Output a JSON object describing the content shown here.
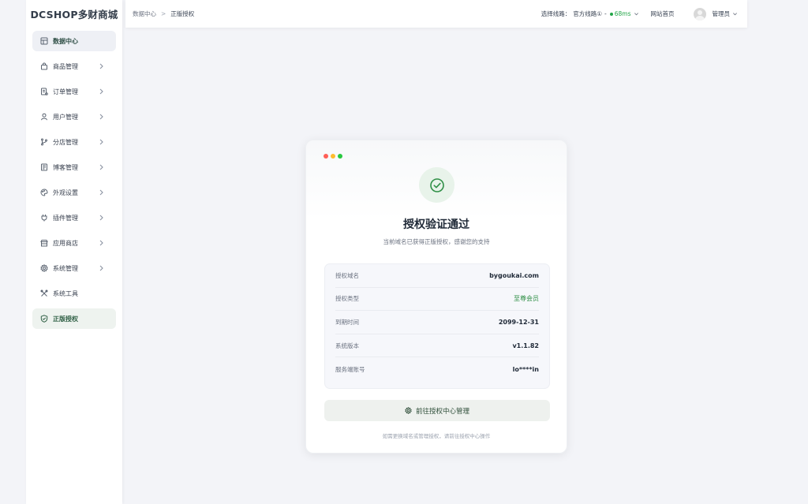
{
  "sidebar": {
    "logo": "DCSHOP多财商城",
    "items": [
      {
        "label": "数据中心",
        "icon": "dashboard-icon",
        "has_chevron": false,
        "active": true
      },
      {
        "label": "商品管理",
        "icon": "shopping-bag-icon",
        "has_chevron": true
      },
      {
        "label": "订单管理",
        "icon": "order-icon",
        "has_chevron": true
      },
      {
        "label": "用户管理",
        "icon": "user-icon",
        "has_chevron": true
      },
      {
        "label": "分店管理",
        "icon": "branch-icon",
        "has_chevron": true
      },
      {
        "label": "博客管理",
        "icon": "blog-icon",
        "has_chevron": true
      },
      {
        "label": "外观设置",
        "icon": "palette-icon",
        "has_chevron": true
      },
      {
        "label": "插件管理",
        "icon": "plug-icon",
        "has_chevron": true
      },
      {
        "label": "应用商店",
        "icon": "store-icon",
        "has_chevron": true
      },
      {
        "label": "系统管理",
        "icon": "gear-icon",
        "has_chevron": true
      },
      {
        "label": "系统工具",
        "icon": "tools-icon",
        "has_chevron": false
      },
      {
        "label": "正版授权",
        "icon": "shield-check-icon",
        "has_chevron": false,
        "active": true
      }
    ]
  },
  "header": {
    "breadcrumb": [
      "数据中心",
      "正版授权"
    ],
    "breadcrumb_sep": ">",
    "route_label": "选择线路：",
    "route_value": "官方线路①",
    "route_dash": "-",
    "latency": "68ms",
    "site_home": "网站首页",
    "user_name": "管理员"
  },
  "card": {
    "title": "授权验证通过",
    "subtitle": "当前域名已获得正版授权，感谢您的支持",
    "rows": [
      {
        "label": "授权域名",
        "value": "bygoukai.com"
      },
      {
        "label": "授权类型",
        "value": "至尊会员"
      },
      {
        "label": "到期时间",
        "value": "2099-12-31"
      },
      {
        "label": "系统版本",
        "value": "v1.1.82"
      },
      {
        "label": "服务端账号",
        "value": "lo****in"
      }
    ],
    "button_label": "前往授权中心管理",
    "hint": "如需更换域名或管理授权，请前往授权中心操作"
  },
  "colors": {
    "accent_green": "#2f8f46",
    "latency_green": "#22a547",
    "traffic_red": "#ff5f57",
    "traffic_yellow": "#febc2e",
    "traffic_green": "#28c840"
  }
}
